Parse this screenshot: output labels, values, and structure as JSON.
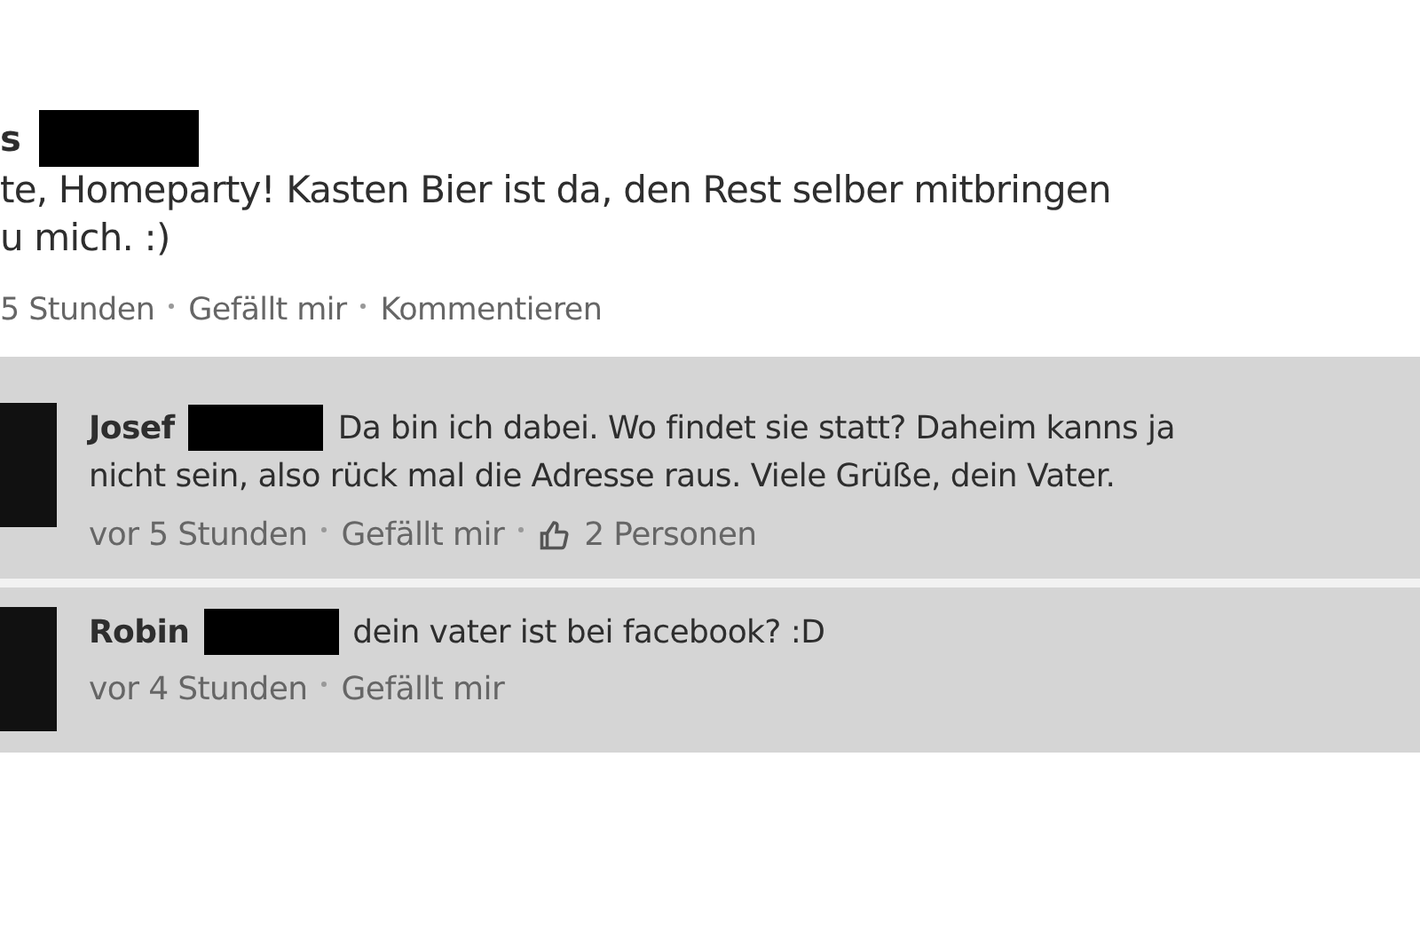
{
  "post": {
    "author": "s",
    "text_lines": [
      "te, Homeparty! Kasten Bier ist da, den Rest selber mitbringen",
      "u mich. :)"
    ],
    "meta": [
      "5 Stunden",
      "Gefällt mir",
      "Kommentieren"
    ]
  },
  "comments": [
    {
      "author": "Josef",
      "text_lines": [
        "Da bin ich dabei. Wo findet sie statt? Daheim kanns ja",
        "nicht sein, also rück mal die Adresse raus. Viele Grüße, dein Vater."
      ],
      "time": "vor 5 Stunden",
      "like": "Gefällt mir",
      "likes": "2 Personen"
    },
    {
      "author": "Robin",
      "text_lines": [
        "dein vater ist bei facebook? :D"
      ],
      "time": "vor 4 Stunden",
      "like": "Gefällt mir"
    }
  ]
}
